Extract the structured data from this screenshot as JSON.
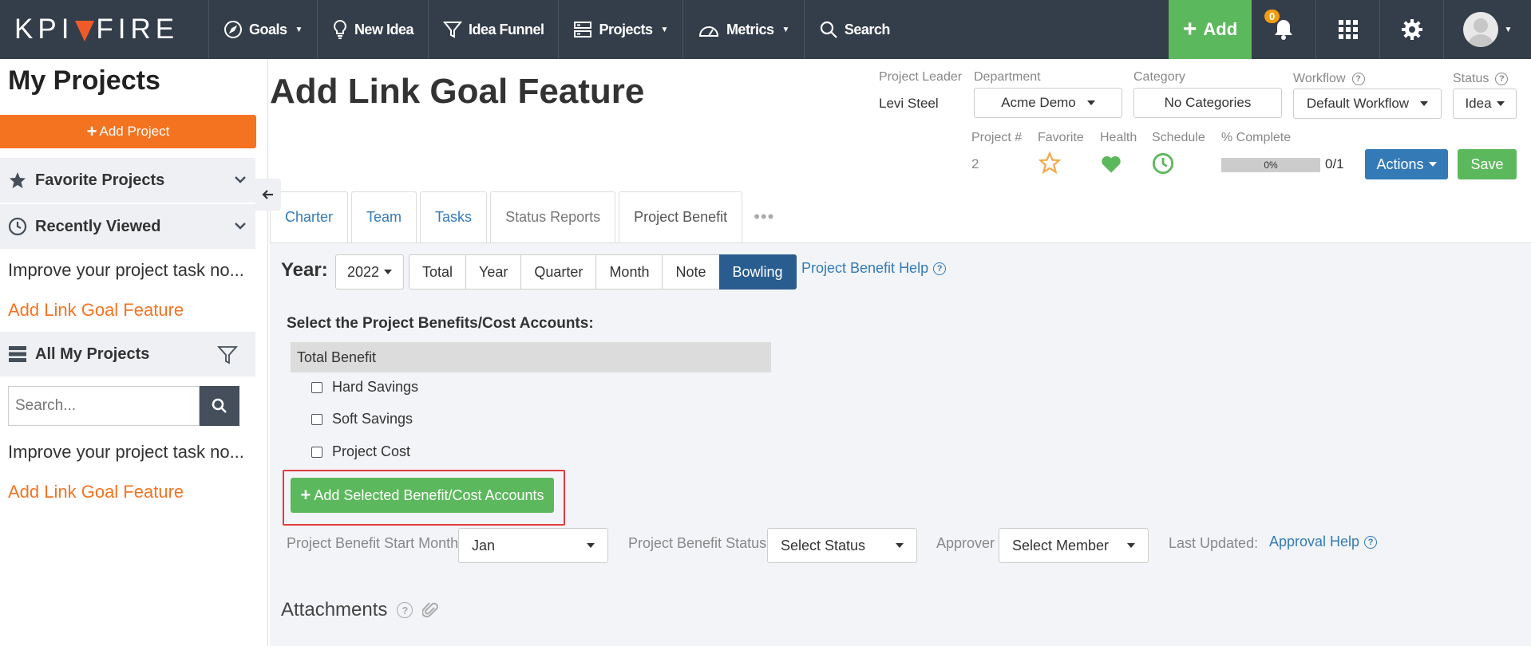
{
  "nav": {
    "logo": {
      "left": "KPI",
      "right": "FIRE"
    },
    "items": [
      {
        "label": "Goals",
        "icon": "compass-icon",
        "has_caret": true
      },
      {
        "label": "New Idea",
        "icon": "lightbulb-icon",
        "has_caret": false
      },
      {
        "label": "Idea Funnel",
        "icon": "funnel-icon",
        "has_caret": false
      },
      {
        "label": "Projects",
        "icon": "server-icon",
        "has_caret": true
      },
      {
        "label": "Metrics",
        "icon": "gauge-icon",
        "has_caret": true
      },
      {
        "label": "Search",
        "icon": "search-icon",
        "has_caret": false
      }
    ],
    "add_label": "Add",
    "notification_count": "0",
    "colors": {
      "bar": "#343e4a",
      "add": "#5cb85c",
      "badge": "#f39c12",
      "brand": "#f47321"
    }
  },
  "sidebar": {
    "title": "My Projects",
    "add_project": "Add Project",
    "favorite": "Favorite Projects",
    "recent": "Recently Viewed",
    "recent_items": [
      "Improve your project task no...",
      "Add Link Goal Feature"
    ],
    "all": "All My Projects",
    "search_placeholder": "Search...",
    "all_items": [
      "Improve your project task no...",
      "Add Link Goal Feature"
    ]
  },
  "project": {
    "title": "Add Link Goal Feature",
    "leader_label": "Project Leader",
    "leader": "Levi Steel",
    "department_label": "Department",
    "department": "Acme Demo",
    "category_label": "Category",
    "category": "No Categories",
    "workflow_label": "Workflow",
    "workflow": "Default Workflow",
    "status_label": "Status",
    "status": "Idea",
    "number_label": "Project #",
    "number": "2",
    "favorite_label": "Favorite",
    "health_label": "Health",
    "schedule_label": "Schedule",
    "complete_label": "% Complete",
    "complete": "0%",
    "tasks_ratio": "0/1",
    "actions": "Actions",
    "save": "Save"
  },
  "tabs": [
    {
      "label": "Charter",
      "style": "link"
    },
    {
      "label": "Team",
      "style": "link"
    },
    {
      "label": "Tasks",
      "style": "link"
    },
    {
      "label": "Status Reports",
      "style": "gray"
    },
    {
      "label": "Project Benefit",
      "style": "active"
    }
  ],
  "tab_more": "•••",
  "benefit": {
    "year_label": "Year:",
    "year": "2022",
    "views": [
      "Total",
      "Year",
      "Quarter",
      "Month",
      "Note",
      "Bowling"
    ],
    "active_view": "Bowling",
    "help": "Project Benefit Help",
    "select_heading": "Select the Project Benefits/Cost Accounts:",
    "total_benefit": "Total Benefit",
    "accounts": [
      "Hard Savings",
      "Soft Savings",
      "Project Cost"
    ],
    "add_selected": "Add Selected Benefit/Cost Accounts",
    "start_month_label": "Project Benefit Start Month",
    "start_month": "Jan",
    "status_label": "Project Benefit Status",
    "status": "Select Status",
    "approver_label": "Approver",
    "approver": "Select Member",
    "last_updated_label": "Last Updated:",
    "approval_help": "Approval Help",
    "attachments": "Attachments"
  }
}
